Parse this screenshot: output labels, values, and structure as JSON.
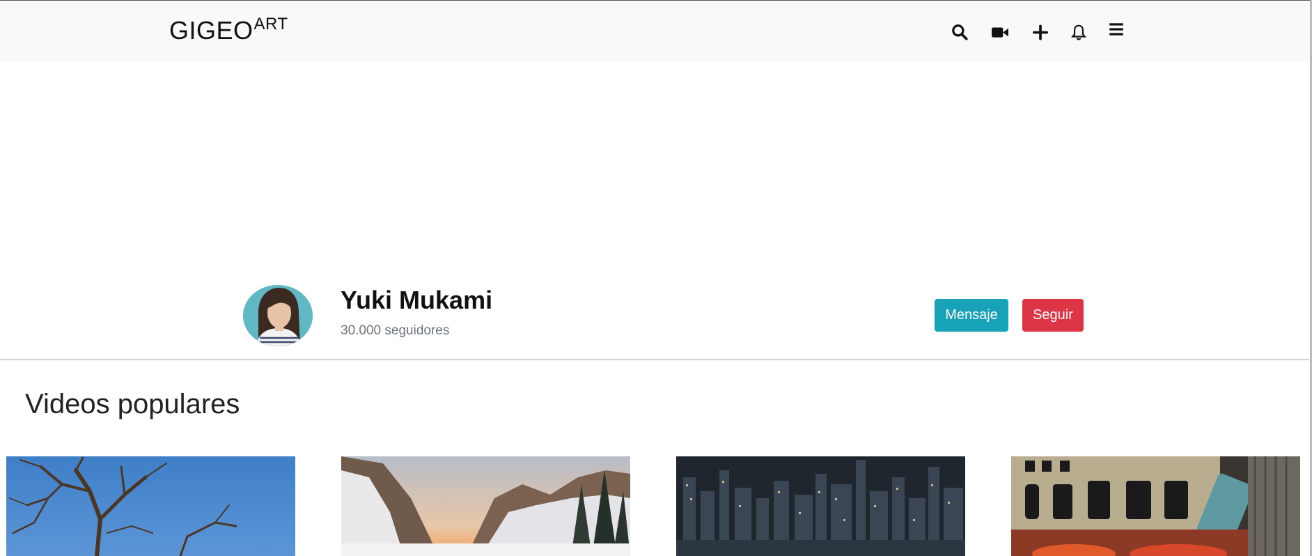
{
  "brand": {
    "name": "GIGEO",
    "suffix": "ART"
  },
  "nav": {
    "icons": [
      "search-icon",
      "video-camera-icon",
      "plus-icon",
      "bell-icon",
      "menu-icon"
    ]
  },
  "profile": {
    "name": "Yuki Mukami",
    "followers": "30.000 seguidores",
    "message_label": "Mensaje",
    "follow_label": "Seguir"
  },
  "colors": {
    "navbar_bg": "#f8f9fa",
    "message_button": "#17a2b8",
    "follow_button": "#dc3545"
  },
  "section": {
    "title": "Videos populares"
  },
  "videos": [
    {
      "thumbnail": "bare-tree-blue-sky"
    },
    {
      "thumbnail": "snowy-mountain-valley-sunset"
    },
    {
      "thumbnail": "city-skyline-night"
    },
    {
      "thumbnail": "japanese-fish-market-sign"
    }
  ]
}
